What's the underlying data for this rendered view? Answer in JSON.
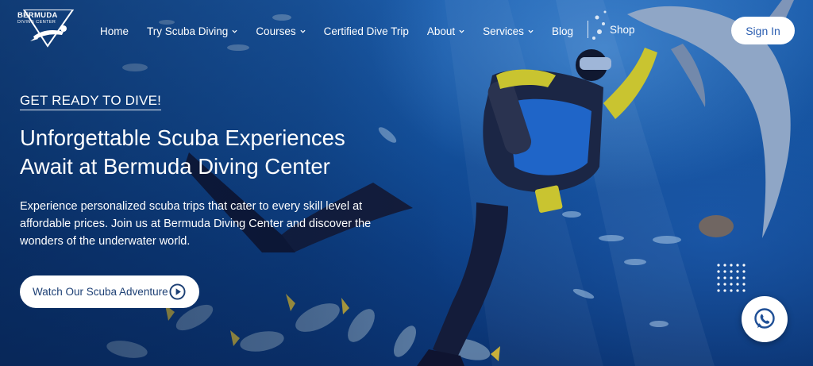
{
  "brand": {
    "name": "BERMUDA",
    "tagline": "DIVING CENTER"
  },
  "nav": {
    "items": [
      {
        "label": "Home",
        "has_dropdown": false
      },
      {
        "label": "Try Scuba Diving",
        "has_dropdown": true
      },
      {
        "label": "Courses",
        "has_dropdown": true
      },
      {
        "label": "Certified Dive Trip",
        "has_dropdown": false
      },
      {
        "label": "About",
        "has_dropdown": true
      },
      {
        "label": "Services",
        "has_dropdown": true
      },
      {
        "label": "Blog",
        "has_dropdown": false
      }
    ],
    "shop_label": "Shop",
    "signin_label": "Sign In"
  },
  "hero": {
    "eyebrow": "GET READY TO DIVE!",
    "headline": "Unforgettable Scuba Experiences Await at Bermuda Diving Center",
    "description": "Experience personalized scuba trips that cater to every skill level at affordable prices. Join us at Bermuda Diving Center and discover the wonders of the underwater world.",
    "cta_label": "Watch Our Scuba Adventure",
    "cta_icon": "play-circle-icon"
  },
  "floating": {
    "chat_icon": "whatsapp-icon"
  },
  "colors": {
    "accent_text": "#2a5db0",
    "ocean": "#134f9a",
    "white": "#ffffff"
  }
}
